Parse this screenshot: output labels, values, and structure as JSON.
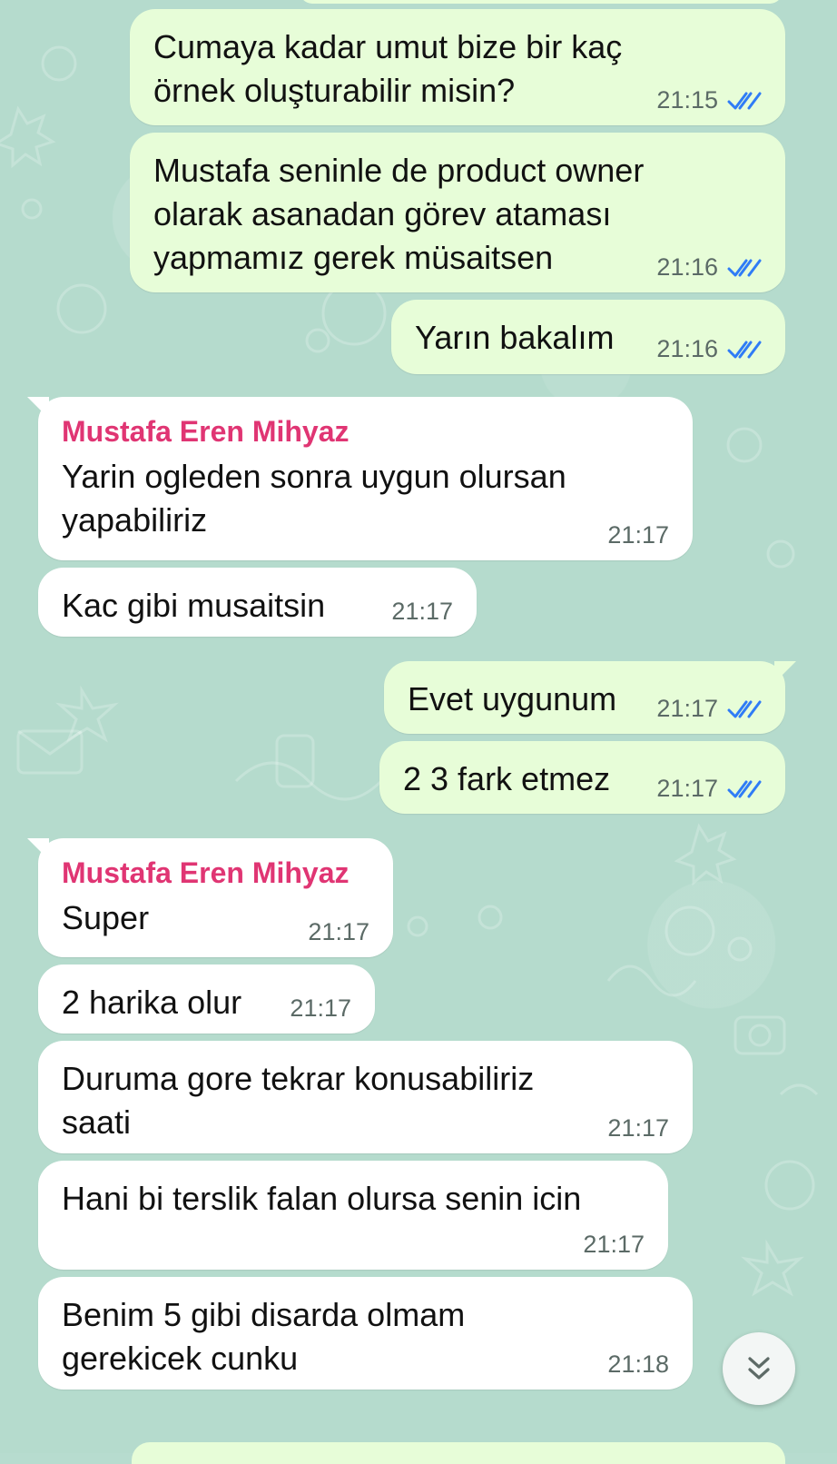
{
  "chat": {
    "messages": [
      {
        "id": "m1",
        "direction": "outgoing",
        "text": "Cumaya kadar umut bize bir kaç\nörnek oluşturabilir misin?",
        "time": "21:15",
        "status": "read"
      },
      {
        "id": "m2",
        "direction": "outgoing",
        "text": "Mustafa seninle de product owner\nolarak asanadan görev ataması\nyapmamız gerek müsaitsen",
        "time": "21:16",
        "status": "read"
      },
      {
        "id": "m3",
        "direction": "outgoing",
        "text": "Yarın bakalım",
        "time": "21:16",
        "status": "read"
      },
      {
        "id": "m4",
        "direction": "incoming",
        "sender": "Mustafa Eren Mihyaz",
        "text": "Yarin ogleden sonra uygun olursan\nyapabiliriz",
        "time": "21:17"
      },
      {
        "id": "m5",
        "direction": "incoming",
        "text": "Kac gibi musaitsin",
        "time": "21:17"
      },
      {
        "id": "m6",
        "direction": "outgoing",
        "text": "Evet uygunum",
        "time": "21:17",
        "status": "read"
      },
      {
        "id": "m7",
        "direction": "outgoing",
        "text": "2 3 fark etmez",
        "time": "21:17",
        "status": "read"
      },
      {
        "id": "m8",
        "direction": "incoming",
        "sender": "Mustafa Eren Mihyaz",
        "text": "Super",
        "time": "21:17"
      },
      {
        "id": "m9",
        "direction": "incoming",
        "text": "2 harika olur",
        "time": "21:17"
      },
      {
        "id": "m10",
        "direction": "incoming",
        "text": "Duruma gore tekrar konusabiliriz\nsaati",
        "time": "21:17"
      },
      {
        "id": "m11",
        "direction": "incoming",
        "text": "Hani bi terslik falan olursa senin icin",
        "time": "21:17"
      },
      {
        "id": "m12",
        "direction": "incoming",
        "text": "Benim 5 gibi disarda olmam\ngerekicek cunku",
        "time": "21:18"
      }
    ]
  },
  "ui": {
    "scroll_button_icon": "double-chevron-down-icon",
    "read_ticks_icon": "double-check-icon",
    "colors": {
      "outgoing_bubble": "#e7fdd8",
      "incoming_bubble": "#ffffff",
      "sender_name": "#e03573",
      "ticks_read": "#2f7cf6",
      "background": "#b5dbcd"
    }
  }
}
